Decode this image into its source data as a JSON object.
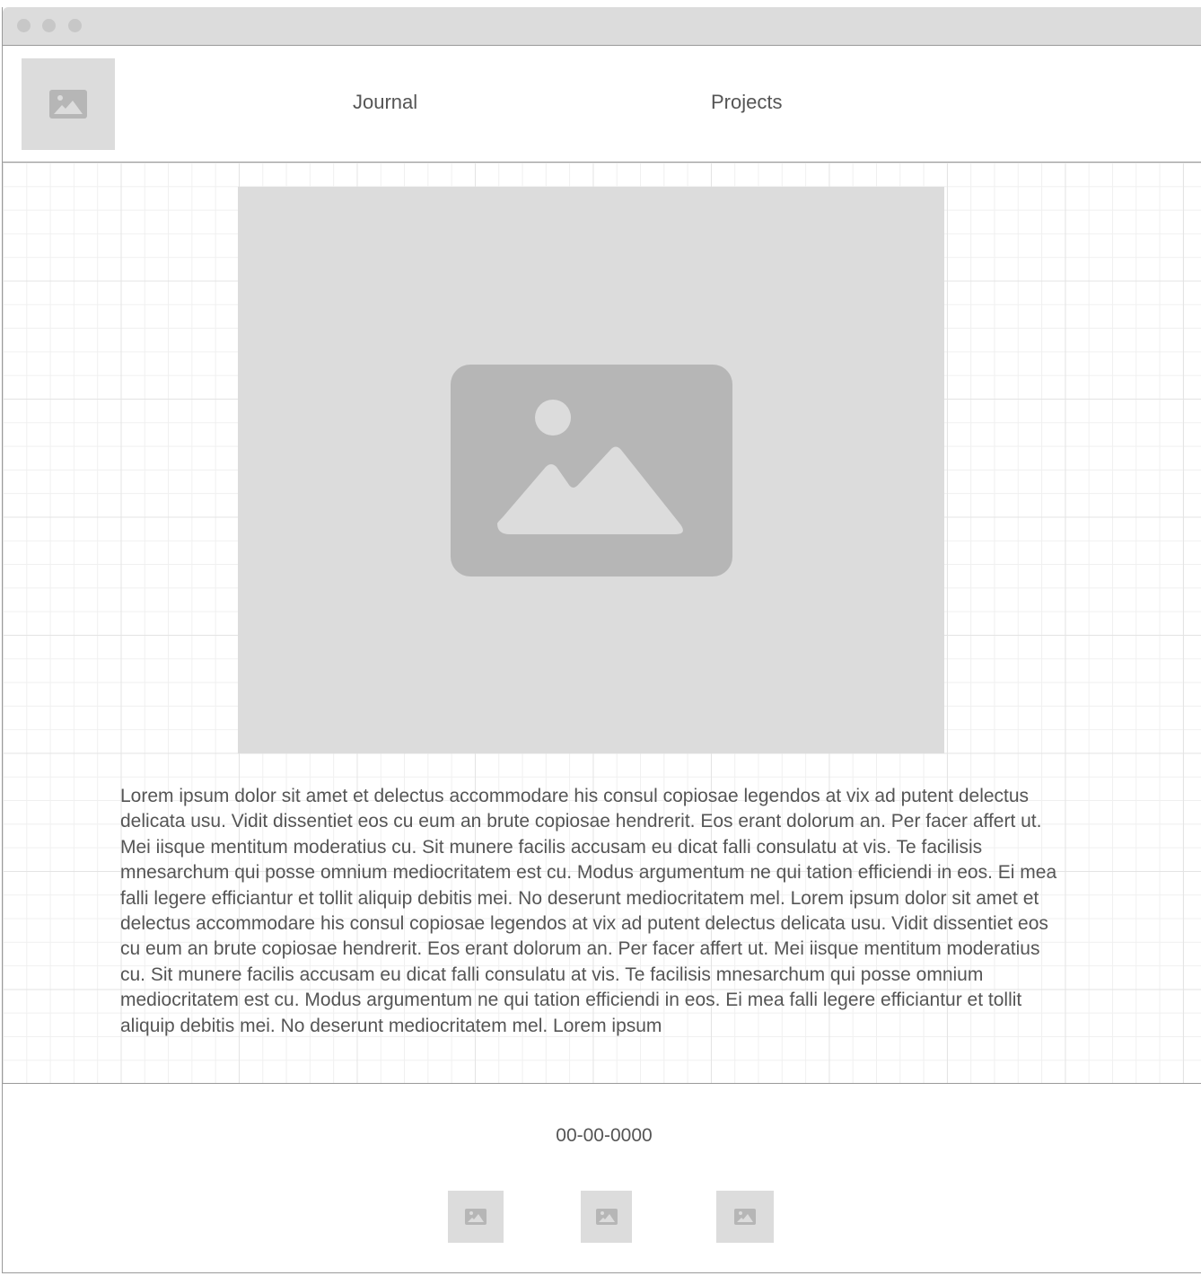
{
  "header": {
    "nav": [
      {
        "label": "Journal"
      },
      {
        "label": "Projects"
      }
    ]
  },
  "main": {
    "body_text": "Lorem ipsum dolor sit amet et delectus accommodare his consul copiosae legendos at vix ad putent delectus delicata usu. Vidit dissentiet eos cu eum an brute copiosae hendrerit. Eos erant dolorum an. Per facer affert ut. Mei iisque mentitum moderatius cu. Sit munere facilis accusam eu dicat falli consulatu at vis. Te facilisis mnesarchum qui posse omnium mediocritatem est cu. Modus argumentum ne qui tation efficiendi in eos. Ei mea falli legere efficiantur et tollit aliquip debitis mei. No deserunt mediocritatem mel. Lorem ipsum dolor sit amet et delectus accommodare his consul copiosae legendos at vix ad putent delectus delicata usu. Vidit dissentiet eos cu eum an brute copiosae hendrerit. Eos erant dolorum an. Per facer affert ut. Mei iisque mentitum moderatius cu. Sit munere facilis accusam eu dicat falli consulatu at vis. Te facilisis mnesarchum qui posse omnium mediocritatem est cu. Modus argumentum ne qui tation efficiendi in eos. Ei mea falli legere efficiantur et tollit aliquip debitis mei. No deserunt mediocritatem mel. Lorem ipsum"
  },
  "footer": {
    "date": "00-00-0000"
  },
  "icons": {
    "logo": "image-placeholder-icon",
    "hero": "image-placeholder-icon",
    "social": [
      "image-placeholder-icon",
      "image-placeholder-icon",
      "image-placeholder-icon"
    ]
  },
  "colors": {
    "placeholder_fill": "#dcdcdc",
    "placeholder_icon": "#b6b6b6",
    "text": "#555555",
    "grid_line": "#e4e4e4"
  }
}
